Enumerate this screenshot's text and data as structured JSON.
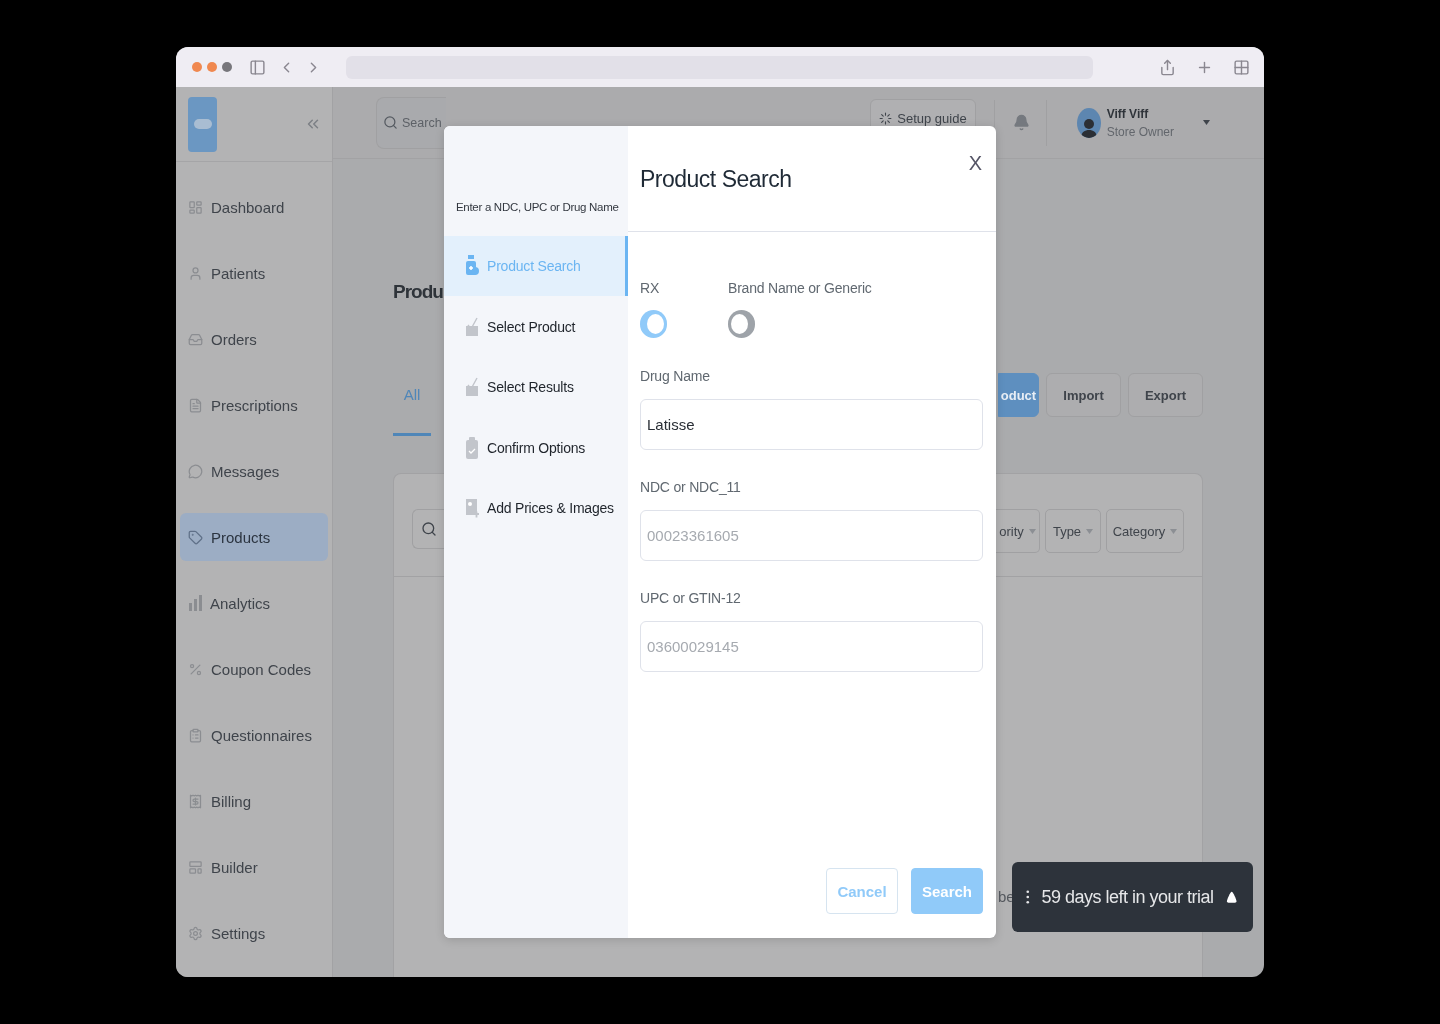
{
  "sidebar": {
    "items": [
      {
        "label": "Dashboard",
        "selected": false
      },
      {
        "label": "Patients",
        "selected": false
      },
      {
        "label": "Orders",
        "selected": false
      },
      {
        "label": "Prescriptions",
        "selected": false
      },
      {
        "label": "Messages",
        "selected": false
      },
      {
        "label": "Products",
        "selected": true
      },
      {
        "label": "Analytics",
        "selected": false
      },
      {
        "label": "Coupon Codes",
        "selected": false
      },
      {
        "label": "Questionnaires",
        "selected": false
      },
      {
        "label": "Billing",
        "selected": false
      },
      {
        "label": "Builder",
        "selected": false
      },
      {
        "label": "Settings",
        "selected": false
      }
    ]
  },
  "header": {
    "search_placeholder": "Search",
    "setup_button": "Setup guide",
    "user": {
      "name": "Viff Viff",
      "role": "Store Owner"
    }
  },
  "page": {
    "title": "Produ",
    "tabs": [
      {
        "label": "All",
        "selected": true
      }
    ],
    "actions": [
      {
        "label": "oduct",
        "kind": "primary"
      },
      {
        "label": "Import",
        "kind": "secondary"
      },
      {
        "label": "Export",
        "kind": "secondary"
      }
    ],
    "filters": [
      "ority",
      "Type",
      "Category"
    ],
    "body_text": "be"
  },
  "trial_banner": {
    "text": "59 days left in your trial"
  },
  "modal": {
    "subtitle": "Enter a NDC, UPC or Drug Name",
    "steps": [
      {
        "label": "Product Search",
        "selected": true
      },
      {
        "label": "Select Product",
        "selected": false
      },
      {
        "label": "Select Results",
        "selected": false
      },
      {
        "label": "Confirm Options",
        "selected": false
      },
      {
        "label": "Add Prices & Images",
        "selected": false
      }
    ],
    "title": "Product Search",
    "close": "X",
    "toggles": [
      {
        "label": "RX",
        "on": true
      },
      {
        "label": "Brand Name or Generic",
        "on": false
      }
    ],
    "fields": [
      {
        "label": "Drug Name",
        "value": "Latisse"
      },
      {
        "label": "NDC or NDC_11",
        "placeholder": "00023361605"
      },
      {
        "label": "UPC or GTIN-12",
        "placeholder": "03600029145"
      }
    ],
    "buttons": [
      {
        "label": "Cancel",
        "kind": "secondary"
      },
      {
        "label": "Search",
        "kind": "primary"
      }
    ]
  }
}
